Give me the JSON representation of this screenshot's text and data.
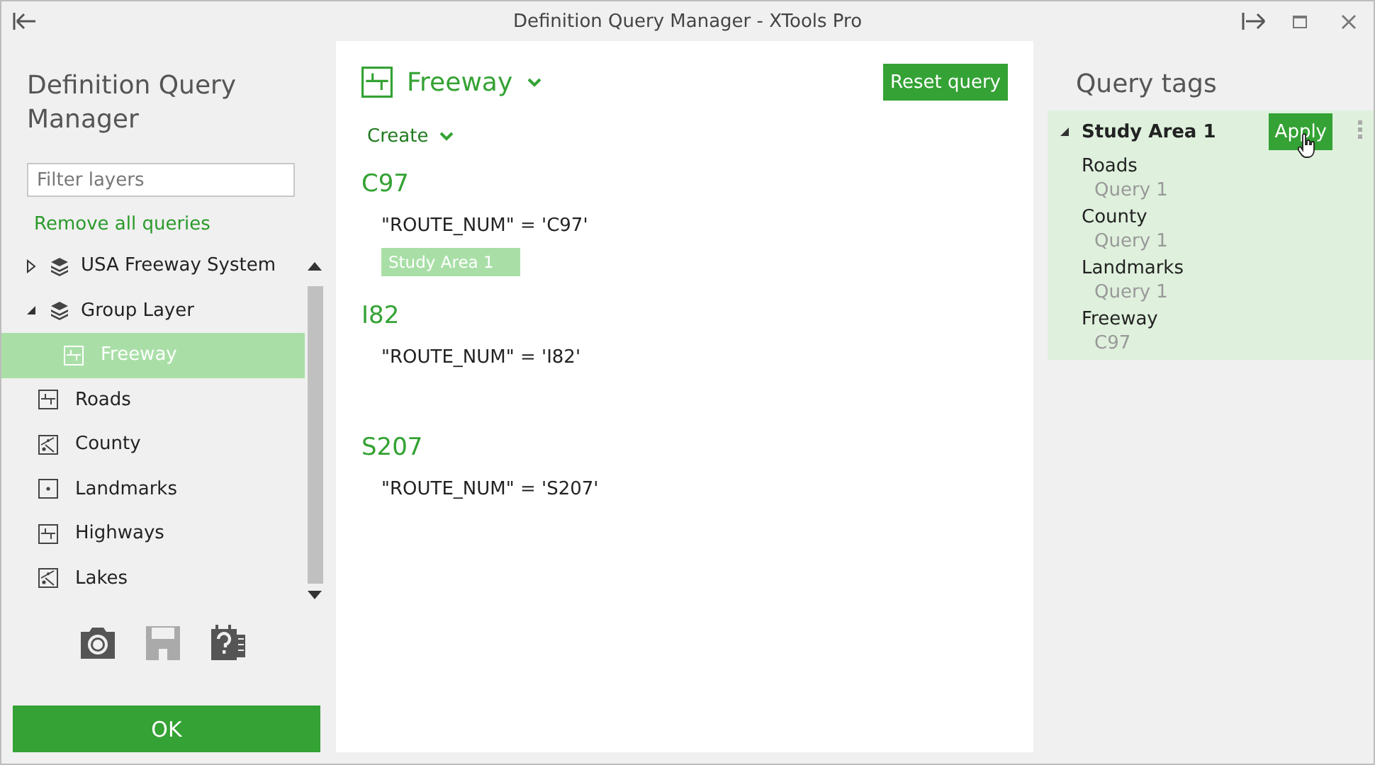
{
  "window": {
    "title": "Definition Query Manager - XTools Pro"
  },
  "sidebar": {
    "title": "Definition Query Manager",
    "filter": {
      "placeholder": "Filter layers"
    },
    "remove_link": "Remove all queries",
    "layers": [
      {
        "name": "USA Freeway System",
        "kind": "group",
        "expanded": false,
        "selected": false
      },
      {
        "name": "Group Layer",
        "kind": "group",
        "expanded": true,
        "selected": false,
        "children": [
          {
            "name": "Freeway",
            "kind": "line",
            "selected": true
          }
        ]
      },
      {
        "name": "Roads",
        "kind": "line",
        "selected": false
      },
      {
        "name": "County",
        "kind": "polygon",
        "selected": false
      },
      {
        "name": "Landmarks",
        "kind": "point",
        "selected": false
      },
      {
        "name": "Highways",
        "kind": "line",
        "selected": false
      },
      {
        "name": "Lakes",
        "kind": "polygon",
        "selected": false
      }
    ],
    "tools": [
      {
        "kind": "camera",
        "disabled": false
      },
      {
        "kind": "save",
        "disabled": true
      },
      {
        "kind": "help",
        "disabled": false
      }
    ],
    "ok_button": "OK"
  },
  "query_panel": {
    "layer": "Freeway",
    "reset_button": "Reset query",
    "create": "Create",
    "queries": [
      {
        "name": "C97",
        "expression": "\"ROUTE_NUM\" = 'C97'",
        "tags": [
          "Study Area 1"
        ]
      },
      {
        "name": "I82",
        "expression": "\"ROUTE_NUM\" = 'I82'"
      },
      {
        "name": "S207",
        "expression": "\"ROUTE_NUM\" = 'S207'"
      }
    ]
  },
  "tags_panel": {
    "title": "Query tags",
    "tags": [
      {
        "name": "Study Area 1",
        "expanded": true,
        "apply_button": "Apply",
        "items": [
          {
            "layer": "Roads",
            "query": "Query 1"
          },
          {
            "layer": "County",
            "query": "Query 1"
          },
          {
            "layer": "Landmarks",
            "query": "Query 1"
          },
          {
            "layer": "Freeway",
            "query": "C97"
          }
        ]
      }
    ]
  }
}
